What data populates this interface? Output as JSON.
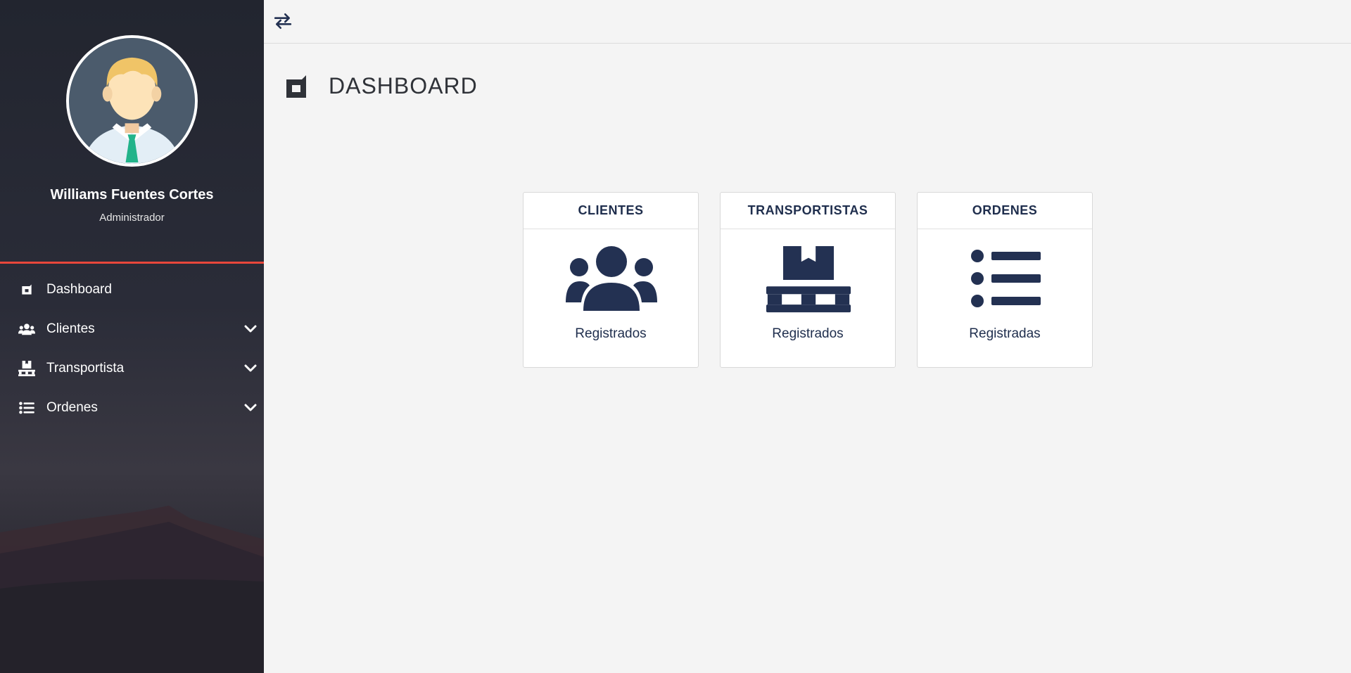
{
  "colors": {
    "accent": "#e8473b",
    "navy": "#233152",
    "sidebar_bg": "#22252f",
    "content_bg": "#f4f4f4"
  },
  "profile": {
    "name": "Williams Fuentes Cortes",
    "role": "Administrador",
    "avatar_icon": "user-avatar"
  },
  "sidebar": {
    "items": [
      {
        "label": "Dashboard",
        "icon": "dashboard-icon",
        "expandable": false
      },
      {
        "label": "Clientes",
        "icon": "users-icon",
        "expandable": true
      },
      {
        "label": "Transportista",
        "icon": "pallet-icon",
        "expandable": true
      },
      {
        "label": "Ordenes",
        "icon": "list-icon",
        "expandable": true
      }
    ]
  },
  "topbar": {
    "toggle_icon": "swap-arrows-icon"
  },
  "page": {
    "title": "DASHBOARD",
    "icon": "dashboard-icon"
  },
  "cards": [
    {
      "title": "CLIENTES",
      "label": "Registrados",
      "icon": "users-icon"
    },
    {
      "title": "TRANSPORTISTAS",
      "label": "Registrados",
      "icon": "pallet-icon"
    },
    {
      "title": "ORDENES",
      "label": "Registradas",
      "icon": "list-icon"
    }
  ]
}
